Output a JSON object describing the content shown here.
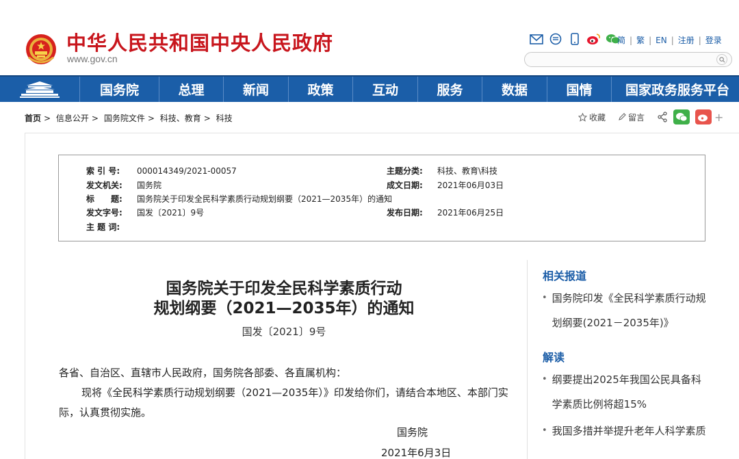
{
  "header": {
    "title": "中华人民共和国中央人民政府",
    "url": "www.gov.cn",
    "lang_links": [
      "简",
      "繁",
      "EN",
      "注册",
      "登录"
    ],
    "search_placeholder": ""
  },
  "nav": [
    "国务院",
    "总理",
    "新闻",
    "政策",
    "互动",
    "服务",
    "数据",
    "国情",
    "国家政务服务平台"
  ],
  "breadcrumb": [
    "首页",
    "信息公开",
    "国务院文件",
    "科技、教育",
    "科技"
  ],
  "tools": {
    "collect": "收藏",
    "comment": "留言",
    "plus": "+"
  },
  "meta": {
    "index_label": "索 引 号:",
    "index_value": "000014349/2021-00057",
    "topic_label": "主题分类:",
    "topic_value": "科技、教育\\科技",
    "issuer_label": "发文机关:",
    "issuer_value": "国务院",
    "created_label": "成文日期:",
    "created_value": "2021年06月03日",
    "title_label": "标　　题:",
    "title_value": "国务院关于印发全民科学素质行动规划纲要（2021—2035年）的通知",
    "docno_label": "发文字号:",
    "docno_value": "国发〔2021〕9号",
    "published_label": "发布日期:",
    "published_value": "2021年06月25日",
    "keywords_label": "主 题 词:",
    "keywords_value": ""
  },
  "article": {
    "title_line1": "国务院关于印发全民科学素质行动",
    "title_line2": "规划纲要（2021—2035年）的通知",
    "doc_number": "国发〔2021〕9号",
    "salutation": "各省、自治区、直辖市人民政府，国务院各部委、各直属机构：",
    "body": "现将《全民科学素质行动规划纲要（2021—2035年）》印发给你们，请结合本地区、本部门实际，认真贯彻实施。",
    "signer": "国务院",
    "date": "2021年6月3日"
  },
  "sidebar": {
    "related_heading": "相关报道",
    "related_items": [
      "国务院印发《全民科学素质行动规划纲要(2021－2035年)》"
    ],
    "interpret_heading": "解读",
    "interpret_items": [
      "纲要提出2025年我国公民具备科学素质比例将超15%",
      "我国多措并举提升老年人科学素质"
    ]
  },
  "colors": {
    "brand_red": "#c8161d",
    "nav_blue": "#1b5ea8",
    "link_blue": "#1b5da7"
  }
}
